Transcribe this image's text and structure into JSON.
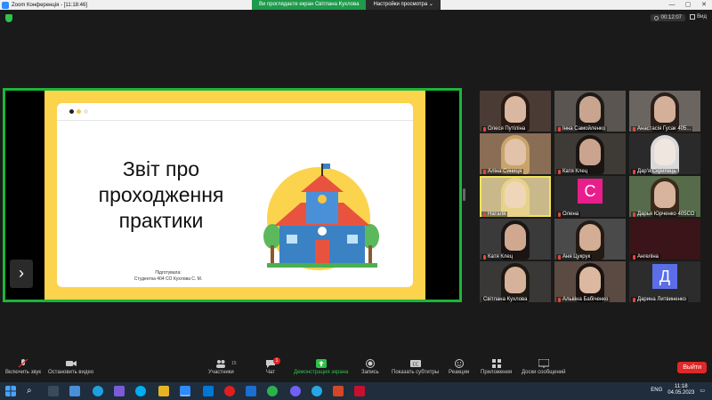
{
  "window": {
    "title": "Zoom Конференція - [11:18:46]",
    "share_banner": "Ви проглядаєте екран Світлана Кухлова",
    "view_options": "Настройки просмотра",
    "controls": [
      "—",
      "▢",
      "✕"
    ]
  },
  "meeting": {
    "timer": "00:12:07",
    "view_label": "Вид"
  },
  "slide": {
    "title": "Звіт про проходження практики",
    "author_line1": "Підготувала:",
    "author_line2": "Студентка 404 СО Кухлова С. М.",
    "dot_colors": [
      "#222222",
      "#f5c542",
      "#e6e6e6"
    ]
  },
  "participants": [
    {
      "name": "Олеся Путіліна",
      "muted": true
    },
    {
      "name": "Інна Самойленко",
      "muted": true
    },
    {
      "name": "Анастасія Гусак 405...",
      "muted": true
    },
    {
      "name": "Аліна Синиця",
      "muted": true
    },
    {
      "name": "Катя Клец",
      "muted": true
    },
    {
      "name": "Дар'я Скрипець",
      "muted": true
    },
    {
      "name": "Наталя",
      "muted": true
    },
    {
      "name": "Олена",
      "muted": true
    },
    {
      "name": "Дарья Юрченко 405СО",
      "muted": true
    },
    {
      "name": "Катя Клец",
      "muted": true
    },
    {
      "name": "Аня Цукрук",
      "muted": true
    },
    {
      "name": "Ангеліна",
      "muted": true
    },
    {
      "name": "Світлана Кухлова",
      "muted": false
    },
    {
      "name": "Альвіна Бабіченко",
      "muted": true
    },
    {
      "name": "Дарина Литвиненко",
      "muted": true
    }
  ],
  "avatars": {
    "olena": "C",
    "daryna": "Д"
  },
  "toolbar": {
    "unmute": "Включить звук",
    "stop_video": "Остановить видео",
    "participants": "Участники",
    "participants_count": "15",
    "chat": "Чат",
    "chat_badge": "1",
    "share_screen": "Демонстрация экрана",
    "record": "Запись",
    "captions": "Показать субтитры",
    "reactions": "Реакции",
    "apps": "Приложения",
    "whiteboards": "Доски сообщений",
    "leave": "Выйти"
  },
  "taskbar": {
    "lang": "ENG",
    "time": "11:18",
    "date": "04.05.2023"
  },
  "colors": {
    "accent_green": "#1db43a",
    "leave_red": "#e02828",
    "slide_yellow": "#fcd34d"
  }
}
